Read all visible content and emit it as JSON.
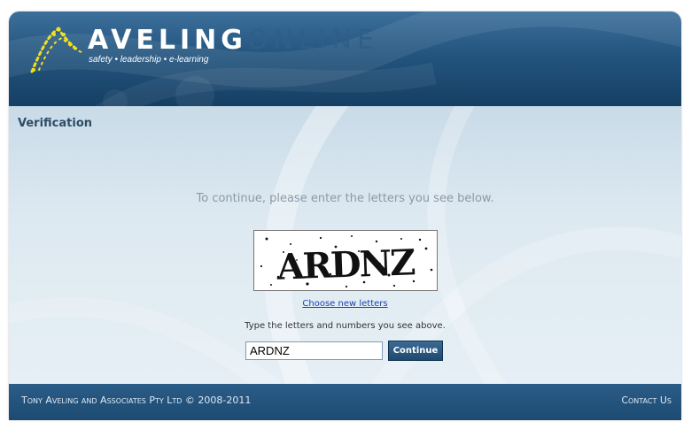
{
  "header": {
    "logo_word1": "AVELING",
    "logo_word2": "ONLINE",
    "tagline": "safety • leadership • e-learning"
  },
  "main": {
    "title": "Verification",
    "instruction": "To continue, please enter the letters you see below.",
    "captcha_text": "ARDNZ",
    "new_letters_link": "Choose new letters",
    "type_hint": "Type the letters and numbers you see above.",
    "answer_value": "ARDNZ",
    "continue_label": "Continue"
  },
  "footer": {
    "copyright": "Tony Aveling and Associates Pty Ltd © 2008-2011",
    "contact_label": "Contact Us"
  },
  "colors": {
    "header_top": "#3c6f9a",
    "header_bottom": "#163f64",
    "footer": "#1c4a72",
    "link": "#1a3fb6",
    "logo_accent": "#f2e01e"
  },
  "icons": {
    "logo_mark": "aveling-logo-icon"
  }
}
